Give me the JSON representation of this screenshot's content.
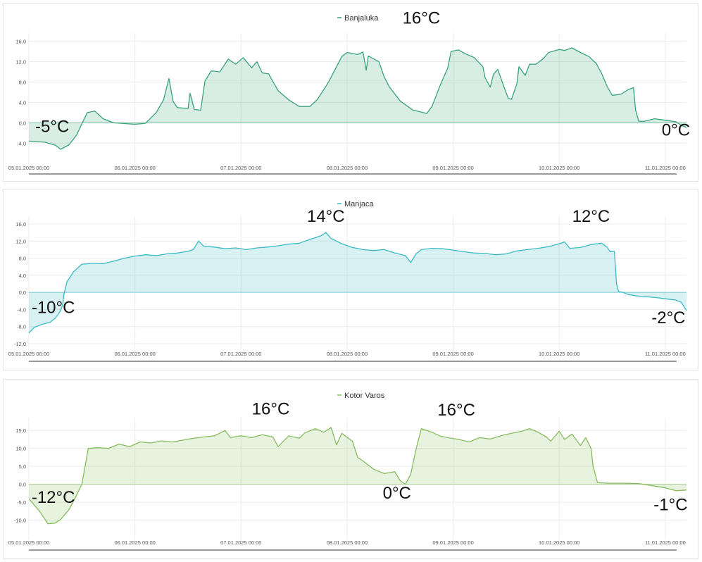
{
  "chart_data": [
    {
      "type": "area",
      "series": [
        {
          "name": "Banjaluka"
        }
      ],
      "color": "#3aa37a",
      "x_ticks": [
        "05.01.2025 00:00",
        "06.01.2025 00:00",
        "07.01.2025 00:00",
        "08.01.2025 00:00",
        "09.01.2025 00:00",
        "10.01.2025 00:00",
        "11.01.2025 00:00"
      ],
      "y_ticks": [
        "16,0",
        "12,0",
        "8,0",
        "4,0",
        "0,0",
        "-4,0"
      ],
      "ylim": [
        -7,
        16.5
      ],
      "xlim": [
        0,
        6.2
      ],
      "points": [
        [
          0,
          -3.6
        ],
        [
          0.15,
          -3.8
        ],
        [
          0.25,
          -4.4
        ],
        [
          0.3,
          -5.2
        ],
        [
          0.38,
          -4.3
        ],
        [
          0.45,
          -2.4
        ],
        [
          0.5,
          -0.2
        ],
        [
          0.55,
          2.0
        ],
        [
          0.62,
          2.3
        ],
        [
          0.7,
          0.8
        ],
        [
          0.8,
          0.0
        ],
        [
          1.0,
          -0.3
        ],
        [
          1.1,
          -0.1
        ],
        [
          1.2,
          2.0
        ],
        [
          1.27,
          4.5
        ],
        [
          1.32,
          8.7
        ],
        [
          1.36,
          4.2
        ],
        [
          1.4,
          3.0
        ],
        [
          1.5,
          2.8
        ],
        [
          1.52,
          5.8
        ],
        [
          1.56,
          2.6
        ],
        [
          1.62,
          2.5
        ],
        [
          1.66,
          8.2
        ],
        [
          1.72,
          10.2
        ],
        [
          1.8,
          10.0
        ],
        [
          1.88,
          12.5
        ],
        [
          1.95,
          11.5
        ],
        [
          2.02,
          12.8
        ],
        [
          2.1,
          10.8
        ],
        [
          2.15,
          12.0
        ],
        [
          2.2,
          9.8
        ],
        [
          2.26,
          9.6
        ],
        [
          2.35,
          6.3
        ],
        [
          2.45,
          4.5
        ],
        [
          2.55,
          3.2
        ],
        [
          2.65,
          3.2
        ],
        [
          2.72,
          4.6
        ],
        [
          2.82,
          7.8
        ],
        [
          2.9,
          11.0
        ],
        [
          2.95,
          13.0
        ],
        [
          3.0,
          13.8
        ],
        [
          3.1,
          13.4
        ],
        [
          3.15,
          13.9
        ],
        [
          3.18,
          10.3
        ],
        [
          3.2,
          13.1
        ],
        [
          3.3,
          12.0
        ],
        [
          3.35,
          9.0
        ],
        [
          3.4,
          7.0
        ],
        [
          3.5,
          4.3
        ],
        [
          3.62,
          2.5
        ],
        [
          3.72,
          2.0
        ],
        [
          3.75,
          1.8
        ],
        [
          3.8,
          3.2
        ],
        [
          3.88,
          7.5
        ],
        [
          3.95,
          10.8
        ],
        [
          3.98,
          14.0
        ],
        [
          4.05,
          14.3
        ],
        [
          4.12,
          13.5
        ],
        [
          4.2,
          12.8
        ],
        [
          4.28,
          11.0
        ],
        [
          4.3,
          8.9
        ],
        [
          4.35,
          7.0
        ],
        [
          4.38,
          9.5
        ],
        [
          4.42,
          10.5
        ],
        [
          4.48,
          7.0
        ],
        [
          4.52,
          4.8
        ],
        [
          4.55,
          4.6
        ],
        [
          4.6,
          7.6
        ],
        [
          4.62,
          11.0
        ],
        [
          4.68,
          9.3
        ],
        [
          4.72,
          11.5
        ],
        [
          4.78,
          11.5
        ],
        [
          4.85,
          12.6
        ],
        [
          4.9,
          13.8
        ],
        [
          5.0,
          14.4
        ],
        [
          5.05,
          14.2
        ],
        [
          5.12,
          14.7
        ],
        [
          5.2,
          13.8
        ],
        [
          5.28,
          13.0
        ],
        [
          5.35,
          11.6
        ],
        [
          5.4,
          9.7
        ],
        [
          5.45,
          7.2
        ],
        [
          5.5,
          5.4
        ],
        [
          5.58,
          5.6
        ],
        [
          5.65,
          6.5
        ],
        [
          5.7,
          6.9
        ],
        [
          5.72,
          2.5
        ],
        [
          5.75,
          0.3
        ],
        [
          5.8,
          0.3
        ],
        [
          5.9,
          0.8
        ],
        [
          6.0,
          0.5
        ],
        [
          6.1,
          0.2
        ],
        [
          6.15,
          -0.5
        ],
        [
          6.2,
          -0.9
        ]
      ],
      "annotations": [
        {
          "text": "16°C",
          "x": 3.7,
          "y": 19.5
        },
        {
          "text": "-5°C",
          "x": 0.22,
          "y": -1.8
        },
        {
          "text": "0°C",
          "x": 6.1,
          "y": -2.5
        }
      ]
    },
    {
      "type": "area",
      "series": [
        {
          "name": "Manjaca"
        }
      ],
      "color": "#3bbac4",
      "x_ticks": [
        "05.01.2025 00:00",
        "06.01.2025 00:00",
        "07.01.2025 00:00",
        "08.01.2025 00:00",
        "09.01.2025 00:00",
        "10.01.2025 00:00",
        "11.01.2025 00:00"
      ],
      "y_ticks": [
        "16,0",
        "12,0",
        "8,0",
        "4,0",
        "0,0",
        "-4,0",
        "-8,0",
        "-12,0"
      ],
      "ylim": [
        -12.5,
        16.5
      ],
      "xlim": [
        0,
        6.2
      ],
      "points": [
        [
          0,
          -9.5
        ],
        [
          0.05,
          -8.2
        ],
        [
          0.12,
          -7.5
        ],
        [
          0.2,
          -7.0
        ],
        [
          0.25,
          -6.0
        ],
        [
          0.28,
          -5.0
        ],
        [
          0.3,
          -4.2
        ],
        [
          0.32,
          -2.8
        ],
        [
          0.33,
          -0.5
        ],
        [
          0.36,
          2.5
        ],
        [
          0.42,
          4.8
        ],
        [
          0.5,
          6.6
        ],
        [
          0.6,
          6.8
        ],
        [
          0.7,
          6.7
        ],
        [
          0.8,
          7.3
        ],
        [
          0.9,
          8.0
        ],
        [
          1.0,
          8.5
        ],
        [
          1.1,
          8.8
        ],
        [
          1.2,
          8.6
        ],
        [
          1.3,
          9.0
        ],
        [
          1.4,
          9.2
        ],
        [
          1.5,
          9.6
        ],
        [
          1.55,
          10.0
        ],
        [
          1.6,
          12.0
        ],
        [
          1.65,
          10.8
        ],
        [
          1.75,
          10.6
        ],
        [
          1.85,
          10.2
        ],
        [
          1.95,
          10.4
        ],
        [
          2.05,
          10.0
        ],
        [
          2.15,
          10.4
        ],
        [
          2.25,
          10.6
        ],
        [
          2.35,
          10.9
        ],
        [
          2.45,
          11.3
        ],
        [
          2.55,
          11.5
        ],
        [
          2.65,
          12.4
        ],
        [
          2.75,
          13.2
        ],
        [
          2.8,
          14.0
        ],
        [
          2.85,
          12.6
        ],
        [
          2.95,
          11.4
        ],
        [
          3.05,
          10.5
        ],
        [
          3.15,
          10.0
        ],
        [
          3.25,
          9.8
        ],
        [
          3.35,
          10.0
        ],
        [
          3.45,
          9.2
        ],
        [
          3.55,
          8.6
        ],
        [
          3.6,
          7.0
        ],
        [
          3.65,
          9.0
        ],
        [
          3.7,
          10.0
        ],
        [
          3.8,
          10.3
        ],
        [
          3.9,
          10.2
        ],
        [
          4.0,
          9.9
        ],
        [
          4.1,
          9.5
        ],
        [
          4.2,
          9.2
        ],
        [
          4.3,
          9.1
        ],
        [
          4.4,
          8.8
        ],
        [
          4.5,
          9.0
        ],
        [
          4.6,
          9.7
        ],
        [
          4.7,
          10.0
        ],
        [
          4.8,
          10.3
        ],
        [
          4.9,
          10.7
        ],
        [
          5.0,
          11.4
        ],
        [
          5.05,
          11.8
        ],
        [
          5.1,
          10.3
        ],
        [
          5.2,
          10.5
        ],
        [
          5.3,
          11.2
        ],
        [
          5.4,
          11.5
        ],
        [
          5.45,
          10.6
        ],
        [
          5.48,
          9.5
        ],
        [
          5.52,
          9.6
        ],
        [
          5.54,
          2.0
        ],
        [
          5.56,
          0.2
        ],
        [
          5.6,
          0.0
        ],
        [
          5.65,
          -0.5
        ],
        [
          5.75,
          -0.9
        ],
        [
          5.9,
          -1.2
        ],
        [
          6.0,
          -1.5
        ],
        [
          6.1,
          -1.8
        ],
        [
          6.15,
          -2.3
        ],
        [
          6.2,
          -4.3
        ]
      ],
      "annotations": [
        {
          "text": "14°C",
          "x": 2.8,
          "y": 16.5
        },
        {
          "text": "12°C",
          "x": 5.3,
          "y": 16.5
        },
        {
          "text": "-10°C",
          "x": 0.23,
          "y": -4.8
        },
        {
          "text": "-2°C",
          "x": 6.03,
          "y": -7.2
        }
      ]
    },
    {
      "type": "area",
      "series": [
        {
          "name": "Kotor Varos"
        }
      ],
      "color": "#86bc5e",
      "x_ticks": [
        "05.01.2025 00:00",
        "06.01.2025 00:00",
        "07.01.2025 00:00",
        "08.01.2025 00:00",
        "09.01.2025 00:00",
        "10.01.2025 00:00",
        "11.01.2025 00:00"
      ],
      "y_ticks": [
        "15,0",
        "10,0",
        "5,0",
        "0,0",
        "-5,0",
        "-10,0"
      ],
      "ylim": [
        -14,
        17
      ],
      "xlim": [
        0,
        6.2
      ],
      "points": [
        [
          0,
          -4.0
        ],
        [
          0.1,
          -7.5
        ],
        [
          0.18,
          -11.0
        ],
        [
          0.25,
          -10.8
        ],
        [
          0.3,
          -9.8
        ],
        [
          0.38,
          -7.0
        ],
        [
          0.45,
          -3.0
        ],
        [
          0.5,
          0.0
        ],
        [
          0.53,
          5.0
        ],
        [
          0.56,
          10.0
        ],
        [
          0.65,
          10.2
        ],
        [
          0.75,
          10.0
        ],
        [
          0.85,
          11.2
        ],
        [
          0.95,
          10.5
        ],
        [
          1.05,
          11.8
        ],
        [
          1.15,
          11.5
        ],
        [
          1.25,
          12.1
        ],
        [
          1.35,
          11.8
        ],
        [
          1.45,
          12.3
        ],
        [
          1.55,
          12.8
        ],
        [
          1.65,
          13.2
        ],
        [
          1.75,
          13.5
        ],
        [
          1.85,
          15.0
        ],
        [
          1.9,
          13.0
        ],
        [
          2.0,
          13.5
        ],
        [
          2.1,
          13.0
        ],
        [
          2.2,
          13.8
        ],
        [
          2.3,
          13.2
        ],
        [
          2.35,
          10.5
        ],
        [
          2.45,
          13.5
        ],
        [
          2.55,
          12.8
        ],
        [
          2.6,
          14.3
        ],
        [
          2.7,
          15.5
        ],
        [
          2.78,
          14.5
        ],
        [
          2.85,
          15.8
        ],
        [
          2.9,
          11.0
        ],
        [
          2.95,
          14.2
        ],
        [
          3.05,
          12.0
        ],
        [
          3.1,
          7.5
        ],
        [
          3.15,
          6.5
        ],
        [
          3.25,
          4.2
        ],
        [
          3.35,
          3.0
        ],
        [
          3.45,
          3.5
        ],
        [
          3.5,
          1.0
        ],
        [
          3.55,
          0.0
        ],
        [
          3.6,
          2.8
        ],
        [
          3.65,
          9.8
        ],
        [
          3.7,
          15.5
        ],
        [
          3.8,
          14.5
        ],
        [
          3.88,
          13.4
        ],
        [
          3.95,
          13.0
        ],
        [
          4.05,
          12.5
        ],
        [
          4.15,
          11.8
        ],
        [
          4.25,
          13.0
        ],
        [
          4.35,
          12.6
        ],
        [
          4.45,
          13.5
        ],
        [
          4.55,
          14.2
        ],
        [
          4.65,
          14.8
        ],
        [
          4.72,
          15.5
        ],
        [
          4.8,
          14.5
        ],
        [
          4.88,
          13.2
        ],
        [
          4.92,
          12.0
        ],
        [
          5.0,
          14.8
        ],
        [
          5.05,
          12.5
        ],
        [
          5.12,
          14.0
        ],
        [
          5.2,
          10.8
        ],
        [
          5.25,
          13.0
        ],
        [
          5.3,
          10.0
        ],
        [
          5.32,
          5.0
        ],
        [
          5.36,
          0.5
        ],
        [
          5.45,
          0.3
        ],
        [
          5.6,
          0.3
        ],
        [
          5.75,
          0.2
        ],
        [
          5.9,
          -0.5
        ],
        [
          6.0,
          -1.0
        ],
        [
          6.1,
          -1.8
        ],
        [
          6.2,
          -1.6
        ]
      ],
      "annotations": [
        {
          "text": "16°C",
          "x": 2.28,
          "y": 19.5
        },
        {
          "text": "16°C",
          "x": 4.03,
          "y": 19.2
        },
        {
          "text": "0°C",
          "x": 3.47,
          "y": -4.0
        },
        {
          "text": "-12°C",
          "x": 0.23,
          "y": -5.2
        },
        {
          "text": "-1°C",
          "x": 6.05,
          "y": -7.2
        }
      ]
    }
  ]
}
